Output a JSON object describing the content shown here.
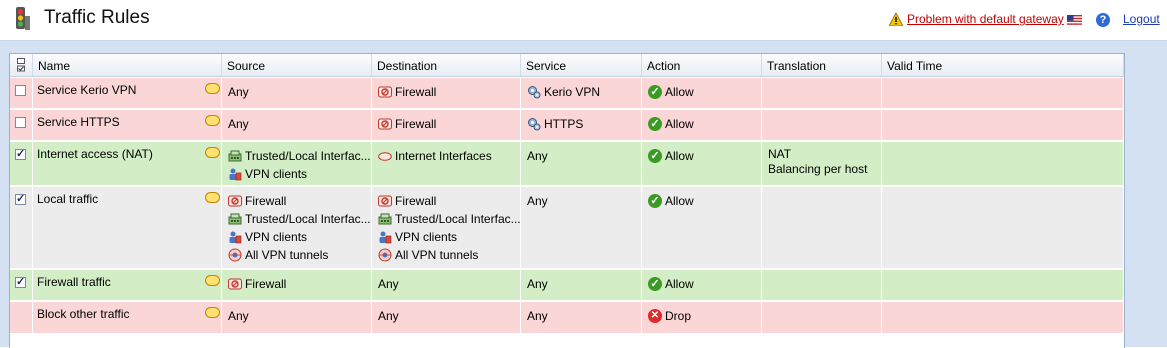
{
  "header": {
    "title": "Traffic Rules",
    "warning_link": "Problem with default gateway",
    "help_symbol": "?",
    "logout": "Logout"
  },
  "columns": [
    "Name",
    "Source",
    "Destination",
    "Service",
    "Action",
    "Translation",
    "Valid Time"
  ],
  "rows": [
    {
      "checked": false,
      "has_checkbox": true,
      "name": "Service Kerio VPN",
      "source": [
        "Any"
      ],
      "destination": [
        "Firewall"
      ],
      "service": [
        "Kerio VPN"
      ],
      "action": "Allow",
      "translation": [],
      "color": "red"
    },
    {
      "checked": false,
      "has_checkbox": true,
      "name": "Service HTTPS",
      "source": [
        "Any"
      ],
      "destination": [
        "Firewall"
      ],
      "service": [
        "HTTPS"
      ],
      "action": "Allow",
      "translation": [],
      "color": "red"
    },
    {
      "checked": true,
      "has_checkbox": true,
      "name": "Internet access (NAT)",
      "source": [
        "Trusted/Local Interfac...",
        "VPN clients"
      ],
      "destination": [
        "Internet Interfaces"
      ],
      "service": [
        "Any"
      ],
      "action": "Allow",
      "translation": [
        "NAT",
        "Balancing per host"
      ],
      "color": "green"
    },
    {
      "checked": true,
      "has_checkbox": true,
      "name": "Local traffic",
      "source": [
        "Firewall",
        "Trusted/Local Interfac...",
        "VPN clients",
        "All VPN tunnels"
      ],
      "destination": [
        "Firewall",
        "Trusted/Local Interfac...",
        "VPN clients",
        "All VPN tunnels"
      ],
      "service": [
        "Any"
      ],
      "action": "Allow",
      "translation": [],
      "color": "gray"
    },
    {
      "checked": true,
      "has_checkbox": true,
      "name": "Firewall traffic",
      "source": [
        "Firewall"
      ],
      "destination": [
        "Any"
      ],
      "service": [
        "Any"
      ],
      "action": "Allow",
      "translation": [],
      "color": "green"
    },
    {
      "checked": false,
      "has_checkbox": false,
      "name": "Block other traffic",
      "source": [
        "Any"
      ],
      "destination": [
        "Any"
      ],
      "service": [
        "Any"
      ],
      "action": "Drop",
      "translation": [],
      "color": "red"
    }
  ],
  "icons": {
    "Firewall": "firewall-icon",
    "Trusted/Local Interfac...": "network-interface-icon",
    "VPN clients": "vpn-clients-icon",
    "All VPN tunnels": "vpn-tunnel-icon",
    "Internet Interfaces": "internet-cloud-icon",
    "Kerio VPN": "service-gear-icon",
    "HTTPS": "service-gear-icon"
  },
  "colors": {
    "red_row": "#fbd6d6",
    "green_row": "#d3eec6",
    "gray_row": "#ececec",
    "allow": "#3c9b24",
    "drop": "#dc2b2b",
    "link_warning": "#c00000"
  }
}
